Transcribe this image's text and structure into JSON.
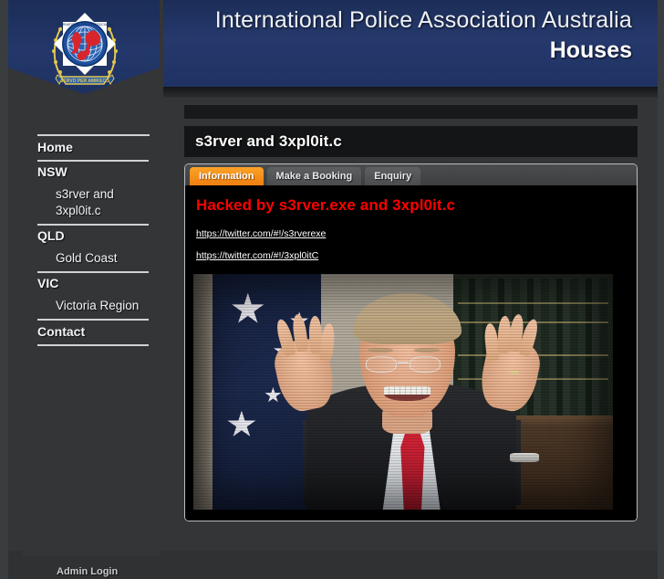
{
  "site": {
    "header_title_main": "International Police Association Australia",
    "header_title_sub": "Houses",
    "logo_alt": "ipa-crest-logo"
  },
  "sidebar": {
    "items": [
      {
        "label": "Home",
        "type": "top"
      },
      {
        "label": "NSW",
        "type": "top"
      },
      {
        "label": "s3rver and 3xpl0it.c",
        "type": "sub"
      },
      {
        "label": "QLD",
        "type": "top"
      },
      {
        "label": "Gold Coast",
        "type": "sub"
      },
      {
        "label": "VIC",
        "type": "top"
      },
      {
        "label": "Victoria Region",
        "type": "sub"
      },
      {
        "label": "Contact",
        "type": "top"
      }
    ]
  },
  "main": {
    "page_title": "s3rver and 3xpl0it.c",
    "tabs": [
      {
        "label": "Information",
        "active": true
      },
      {
        "label": "Make a Booking",
        "active": false
      },
      {
        "label": "Enquiry",
        "active": false
      }
    ],
    "hacked_heading": "Hacked by s3rver.exe and 3xpl0it.c",
    "links": [
      {
        "text": "https://twitter.com/#!/s3rverexe"
      },
      {
        "text": "https://twitter.com/#!/3xpl0itC"
      }
    ],
    "photo_alt": "man-with-raised-hands-photo"
  },
  "footer": {
    "admin_login": "Admin Login"
  },
  "colors": {
    "header_navy": "#23376a",
    "sidebar_gray": "#333537",
    "panel_black": "#000000",
    "tab_active_orange": "#f59220",
    "hacked_red": "#ff0000",
    "rule_gray": "#cfd2d4"
  }
}
